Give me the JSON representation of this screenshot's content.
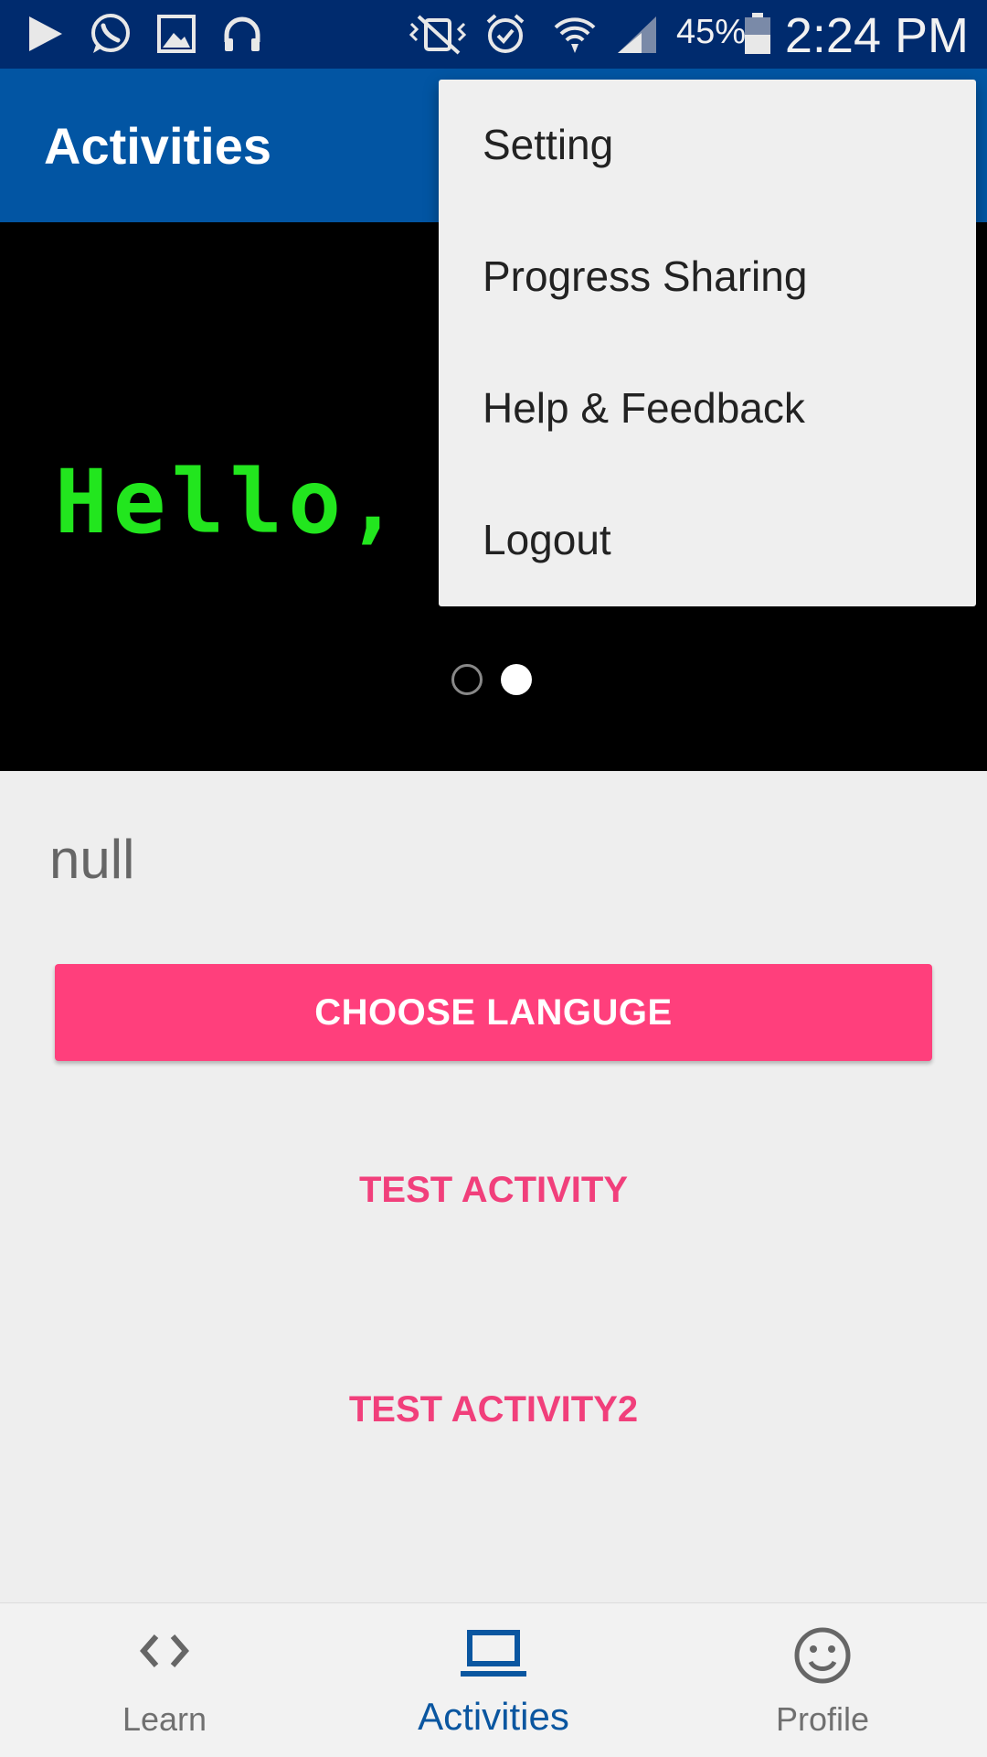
{
  "status_bar": {
    "battery": "45%",
    "time": "2:24 PM",
    "icons": [
      "play-icon",
      "whatsapp-icon",
      "image-icon",
      "headphones-icon",
      "vibrate-mute-icon",
      "alarm-icon",
      "wifi-icon",
      "signal-icon",
      "battery-icon"
    ]
  },
  "app_bar": {
    "title": "Activities"
  },
  "banner": {
    "text": "Hello,",
    "page_count": 2,
    "current_page": 2
  },
  "content": {
    "null_label": "null",
    "choose_button": "CHOOSE LANGUGE",
    "test_activity": "TEST ACTIVITY",
    "test_activity2": "TEST ACTIVITY2"
  },
  "menu": {
    "items": [
      {
        "label": "Setting"
      },
      {
        "label": "Progress Sharing"
      },
      {
        "label": "Help & Feedback"
      },
      {
        "label": "Logout"
      }
    ]
  },
  "bottom_nav": {
    "items": [
      {
        "label": "Learn",
        "icon": "code-icon"
      },
      {
        "label": "Activities",
        "icon": "laptop-icon",
        "active": true
      },
      {
        "label": "Profile",
        "icon": "smiley-icon"
      }
    ]
  },
  "colors": {
    "status_bar": "#002b6e",
    "app_bar": "#0255a3",
    "accent": "#ff3f7c",
    "banner_text": "#22e61e",
    "active_nav": "#0a56a0"
  }
}
